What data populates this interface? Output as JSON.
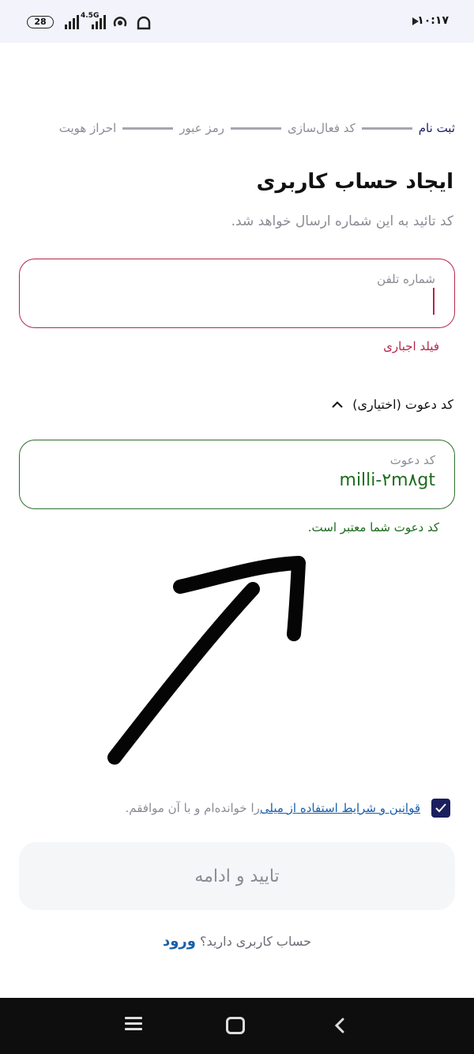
{
  "status_bar": {
    "battery": "28",
    "network": "4.5G",
    "time": "۱۰:۱۷"
  },
  "stepper": {
    "steps": [
      "ثبت نام",
      "کد فعال‌سازی",
      "رمز عبور",
      "احراز هویت"
    ],
    "active_index": 0
  },
  "header": {
    "title": "ایجاد حساب کاربری",
    "subtitle": "کد تائید به این شماره ارسال خواهد شد."
  },
  "phone_field": {
    "label": "شماره تلفن",
    "value": "",
    "error": "فیلد اجباری"
  },
  "invite_section": {
    "toggle_label": "کد دعوت (اختیاری)",
    "field_label": "کد دعوت",
    "value": "milli-۲m۸gt",
    "valid_message": "کد دعوت شما معتبر است."
  },
  "terms": {
    "checked": true,
    "link_text": "قوانین و شرایط استفاده از میلی",
    "suffix": " را خوانده‌ام و با آن موافقم."
  },
  "confirm_button": {
    "label": "تایید و ادامه"
  },
  "login_prompt": {
    "question": "حساب کاربری دارید؟ ",
    "link": "ورود"
  },
  "colors": {
    "primary": "#1b1f5e",
    "error": "#b5264a",
    "success": "#1d6b1d",
    "link": "#1a5fa8"
  }
}
